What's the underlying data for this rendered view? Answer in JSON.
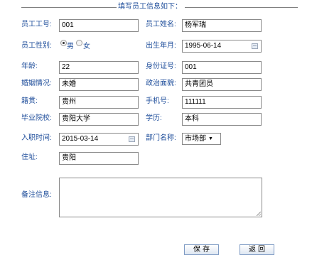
{
  "form": {
    "title": "填写员工信息如下：",
    "fields": {
      "employee_id": {
        "label": "员工工号:",
        "value": "001"
      },
      "employee_name": {
        "label": "员工姓名:",
        "value": "杨军瑞"
      },
      "gender": {
        "label": "员工性别:",
        "options": [
          "男",
          "女"
        ],
        "selected": "男"
      },
      "birth_date": {
        "label": "出生年月:",
        "value": "1995-06-14"
      },
      "age": {
        "label": "年龄:",
        "value": "22"
      },
      "id_number": {
        "label": "身份证号:",
        "value": "001"
      },
      "marital_status": {
        "label": "婚姻情况:",
        "value": "未婚"
      },
      "political_status": {
        "label": "政治面貌:",
        "value": "共青团员"
      },
      "native_place": {
        "label": "籍贯:",
        "value": "贵州"
      },
      "phone": {
        "label": "手机号:",
        "value": "111111"
      },
      "school": {
        "label": "毕业院校:",
        "value": "贵阳大学"
      },
      "education": {
        "label": "学历:",
        "value": "本科"
      },
      "hire_date": {
        "label": "入职时间:",
        "value": "2015-03-14"
      },
      "department": {
        "label": "部门名称:",
        "value": "市场部"
      },
      "address": {
        "label": "住址:",
        "value": "贵阳"
      },
      "remarks": {
        "label": "备注信息:",
        "value": ""
      }
    }
  },
  "buttons": {
    "save": "保存",
    "back": "返回"
  },
  "icons": {
    "date_picker": "calendar-icon",
    "dropdown": "chevron-down-icon"
  },
  "colors": {
    "label": "#1f4e9b",
    "border": "#8a8a8a",
    "button_border": "#7f9bc4"
  }
}
